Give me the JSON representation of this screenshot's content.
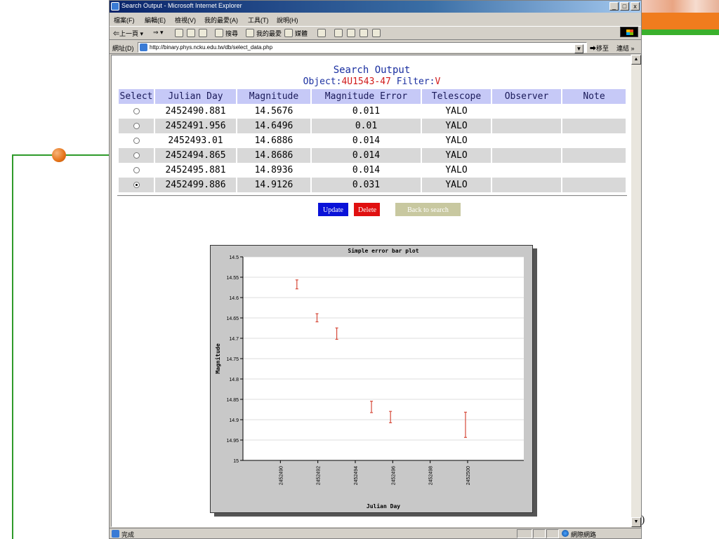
{
  "window": {
    "title": "Search Output - Microsoft Internet Explorer",
    "controls": [
      "_",
      "□",
      "x"
    ]
  },
  "menu": [
    "檔案(F)",
    "編輯(E)",
    "檢視(V)",
    "我的最愛(A)",
    "工具(T)",
    "說明(H)"
  ],
  "toolbar": {
    "back": "⇐上一頁 ▾",
    "forward": "⇒ ▾",
    "search": "搜尋",
    "favorites": "我的最愛",
    "media": "媒體"
  },
  "address": {
    "label": "網址(D)",
    "url": "http://binary.phys.ncku.edu.tw/db/select_data.php",
    "go": "移至",
    "links": "連結 »"
  },
  "page": {
    "title": "Search Output",
    "object_label": "Object:",
    "object_value": "4U1543-47",
    "filter_label": "Filter:",
    "filter_value": "V"
  },
  "table": {
    "headers": [
      "Select",
      "Julian Day",
      "Magnitude",
      "Magnitude Error",
      "Telescope",
      "Observer",
      "Note"
    ],
    "rows": [
      {
        "selected": false,
        "jd": "2452490.881",
        "mag": "14.5676",
        "err": "0.011",
        "tel": "YALO",
        "obs": "",
        "note": ""
      },
      {
        "selected": false,
        "jd": "2452491.956",
        "mag": "14.6496",
        "err": "0.01",
        "tel": "YALO",
        "obs": "",
        "note": ""
      },
      {
        "selected": false,
        "jd": "2452493.01",
        "mag": "14.6886",
        "err": "0.014",
        "tel": "YALO",
        "obs": "",
        "note": ""
      },
      {
        "selected": false,
        "jd": "2452494.865",
        "mag": "14.8686",
        "err": "0.014",
        "tel": "YALO",
        "obs": "",
        "note": ""
      },
      {
        "selected": false,
        "jd": "2452495.881",
        "mag": "14.8936",
        "err": "0.014",
        "tel": "YALO",
        "obs": "",
        "note": ""
      },
      {
        "selected": true,
        "jd": "2452499.886",
        "mag": "14.9126",
        "err": "0.031",
        "tel": "YALO",
        "obs": "",
        "note": ""
      }
    ]
  },
  "buttons": {
    "update": "Update",
    "delete": "Delete",
    "back": "Back to search"
  },
  "chart_data": {
    "type": "scatter",
    "title": "Simple error bar plot",
    "xlabel": "Julian Day",
    "ylabel": "Magnitude",
    "xlim": [
      2452488,
      2452503
    ],
    "ylim": [
      14.5,
      15
    ],
    "y_inverted": true,
    "xticks": [
      2452490,
      2452492,
      2452494,
      2452496,
      2452498,
      2452500
    ],
    "yticks": [
      14.5,
      14.55,
      14.6,
      14.65,
      14.7,
      14.75,
      14.8,
      14.85,
      14.9,
      14.95,
      15
    ],
    "grid": true,
    "series": [
      {
        "color": "#d64a3a",
        "points": [
          {
            "x": 2452490.881,
            "y": 14.5676,
            "err": 0.011
          },
          {
            "x": 2452491.956,
            "y": 14.6496,
            "err": 0.01
          },
          {
            "x": 2452493.01,
            "y": 14.6886,
            "err": 0.014
          },
          {
            "x": 2452494.865,
            "y": 14.8686,
            "err": 0.014
          },
          {
            "x": 2452495.881,
            "y": 14.8936,
            "err": 0.014
          },
          {
            "x": 2452499.886,
            "y": 14.9126,
            "err": 0.031
          }
        ]
      }
    ]
  },
  "status": {
    "text": "完成",
    "zone": "網際網路"
  },
  "slide": {
    "page_number": ")"
  }
}
